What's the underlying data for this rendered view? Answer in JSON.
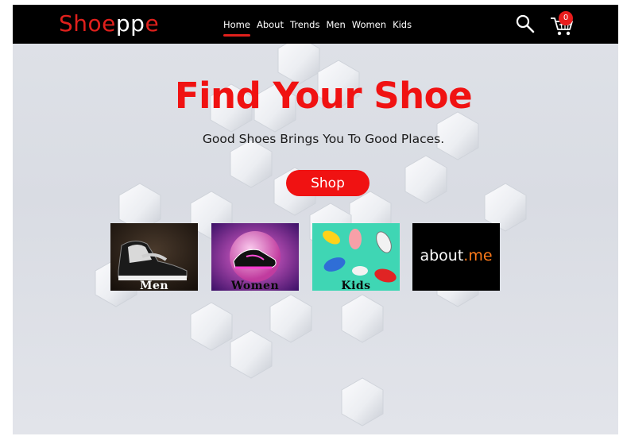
{
  "brand": {
    "logo_part1": "Shoe",
    "logo_part2": "pp",
    "logo_part3": "e"
  },
  "nav": {
    "items": [
      {
        "label": "Home",
        "active": true
      },
      {
        "label": "About"
      },
      {
        "label": "Trends"
      },
      {
        "label": "Men"
      },
      {
        "label": "Women"
      },
      {
        "label": "Kids"
      }
    ]
  },
  "header_icons": {
    "search": "search-icon",
    "cart": "cart-icon",
    "cart_count": "0"
  },
  "hero": {
    "title": "Find Your Shoe",
    "subtitle": "Good Shoes Brings You To Good Places.",
    "button_label": "Shop"
  },
  "categories": [
    {
      "label": "Men"
    },
    {
      "label": "Women"
    },
    {
      "label": "Kids"
    },
    {
      "logo_main": "about",
      "logo_accent": ".me"
    }
  ],
  "colors": {
    "accent": "#f01212",
    "navbar": "#000000",
    "background": "#dfe2e8"
  }
}
